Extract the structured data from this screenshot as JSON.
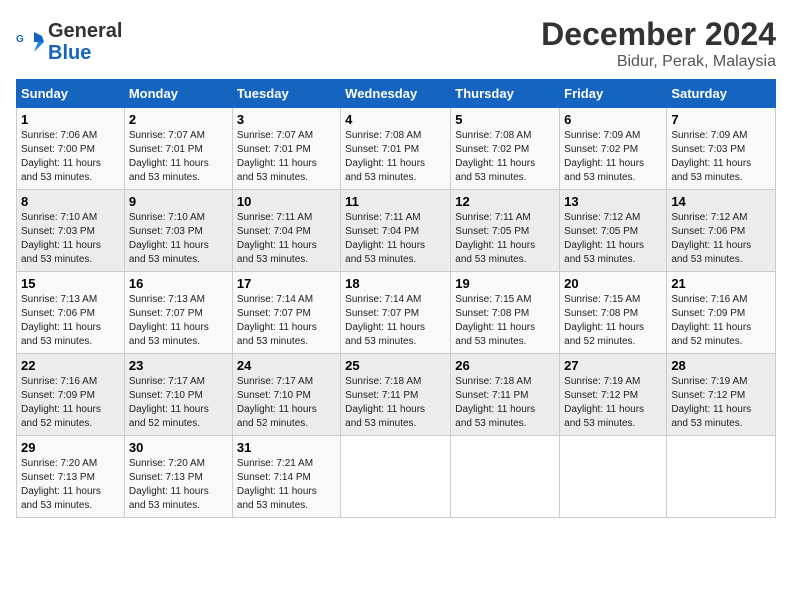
{
  "logo": {
    "line1": "General",
    "line2": "Blue"
  },
  "title": "December 2024",
  "subtitle": "Bidur, Perak, Malaysia",
  "days_of_week": [
    "Sunday",
    "Monday",
    "Tuesday",
    "Wednesday",
    "Thursday",
    "Friday",
    "Saturday"
  ],
  "weeks": [
    [
      {
        "day": "1",
        "info": "Sunrise: 7:06 AM\nSunset: 7:00 PM\nDaylight: 11 hours\nand 53 minutes."
      },
      {
        "day": "2",
        "info": "Sunrise: 7:07 AM\nSunset: 7:01 PM\nDaylight: 11 hours\nand 53 minutes."
      },
      {
        "day": "3",
        "info": "Sunrise: 7:07 AM\nSunset: 7:01 PM\nDaylight: 11 hours\nand 53 minutes."
      },
      {
        "day": "4",
        "info": "Sunrise: 7:08 AM\nSunset: 7:01 PM\nDaylight: 11 hours\nand 53 minutes."
      },
      {
        "day": "5",
        "info": "Sunrise: 7:08 AM\nSunset: 7:02 PM\nDaylight: 11 hours\nand 53 minutes."
      },
      {
        "day": "6",
        "info": "Sunrise: 7:09 AM\nSunset: 7:02 PM\nDaylight: 11 hours\nand 53 minutes."
      },
      {
        "day": "7",
        "info": "Sunrise: 7:09 AM\nSunset: 7:03 PM\nDaylight: 11 hours\nand 53 minutes."
      }
    ],
    [
      {
        "day": "8",
        "info": "Sunrise: 7:10 AM\nSunset: 7:03 PM\nDaylight: 11 hours\nand 53 minutes."
      },
      {
        "day": "9",
        "info": "Sunrise: 7:10 AM\nSunset: 7:03 PM\nDaylight: 11 hours\nand 53 minutes."
      },
      {
        "day": "10",
        "info": "Sunrise: 7:11 AM\nSunset: 7:04 PM\nDaylight: 11 hours\nand 53 minutes."
      },
      {
        "day": "11",
        "info": "Sunrise: 7:11 AM\nSunset: 7:04 PM\nDaylight: 11 hours\nand 53 minutes."
      },
      {
        "day": "12",
        "info": "Sunrise: 7:11 AM\nSunset: 7:05 PM\nDaylight: 11 hours\nand 53 minutes."
      },
      {
        "day": "13",
        "info": "Sunrise: 7:12 AM\nSunset: 7:05 PM\nDaylight: 11 hours\nand 53 minutes."
      },
      {
        "day": "14",
        "info": "Sunrise: 7:12 AM\nSunset: 7:06 PM\nDaylight: 11 hours\nand 53 minutes."
      }
    ],
    [
      {
        "day": "15",
        "info": "Sunrise: 7:13 AM\nSunset: 7:06 PM\nDaylight: 11 hours\nand 53 minutes."
      },
      {
        "day": "16",
        "info": "Sunrise: 7:13 AM\nSunset: 7:07 PM\nDaylight: 11 hours\nand 53 minutes."
      },
      {
        "day": "17",
        "info": "Sunrise: 7:14 AM\nSunset: 7:07 PM\nDaylight: 11 hours\nand 53 minutes."
      },
      {
        "day": "18",
        "info": "Sunrise: 7:14 AM\nSunset: 7:07 PM\nDaylight: 11 hours\nand 53 minutes."
      },
      {
        "day": "19",
        "info": "Sunrise: 7:15 AM\nSunset: 7:08 PM\nDaylight: 11 hours\nand 53 minutes."
      },
      {
        "day": "20",
        "info": "Sunrise: 7:15 AM\nSunset: 7:08 PM\nDaylight: 11 hours\nand 52 minutes."
      },
      {
        "day": "21",
        "info": "Sunrise: 7:16 AM\nSunset: 7:09 PM\nDaylight: 11 hours\nand 52 minutes."
      }
    ],
    [
      {
        "day": "22",
        "info": "Sunrise: 7:16 AM\nSunset: 7:09 PM\nDaylight: 11 hours\nand 52 minutes."
      },
      {
        "day": "23",
        "info": "Sunrise: 7:17 AM\nSunset: 7:10 PM\nDaylight: 11 hours\nand 52 minutes."
      },
      {
        "day": "24",
        "info": "Sunrise: 7:17 AM\nSunset: 7:10 PM\nDaylight: 11 hours\nand 52 minutes."
      },
      {
        "day": "25",
        "info": "Sunrise: 7:18 AM\nSunset: 7:11 PM\nDaylight: 11 hours\nand 53 minutes."
      },
      {
        "day": "26",
        "info": "Sunrise: 7:18 AM\nSunset: 7:11 PM\nDaylight: 11 hours\nand 53 minutes."
      },
      {
        "day": "27",
        "info": "Sunrise: 7:19 AM\nSunset: 7:12 PM\nDaylight: 11 hours\nand 53 minutes."
      },
      {
        "day": "28",
        "info": "Sunrise: 7:19 AM\nSunset: 7:12 PM\nDaylight: 11 hours\nand 53 minutes."
      }
    ],
    [
      {
        "day": "29",
        "info": "Sunrise: 7:20 AM\nSunset: 7:13 PM\nDaylight: 11 hours\nand 53 minutes."
      },
      {
        "day": "30",
        "info": "Sunrise: 7:20 AM\nSunset: 7:13 PM\nDaylight: 11 hours\nand 53 minutes."
      },
      {
        "day": "31",
        "info": "Sunrise: 7:21 AM\nSunset: 7:14 PM\nDaylight: 11 hours\nand 53 minutes."
      },
      null,
      null,
      null,
      null
    ]
  ]
}
